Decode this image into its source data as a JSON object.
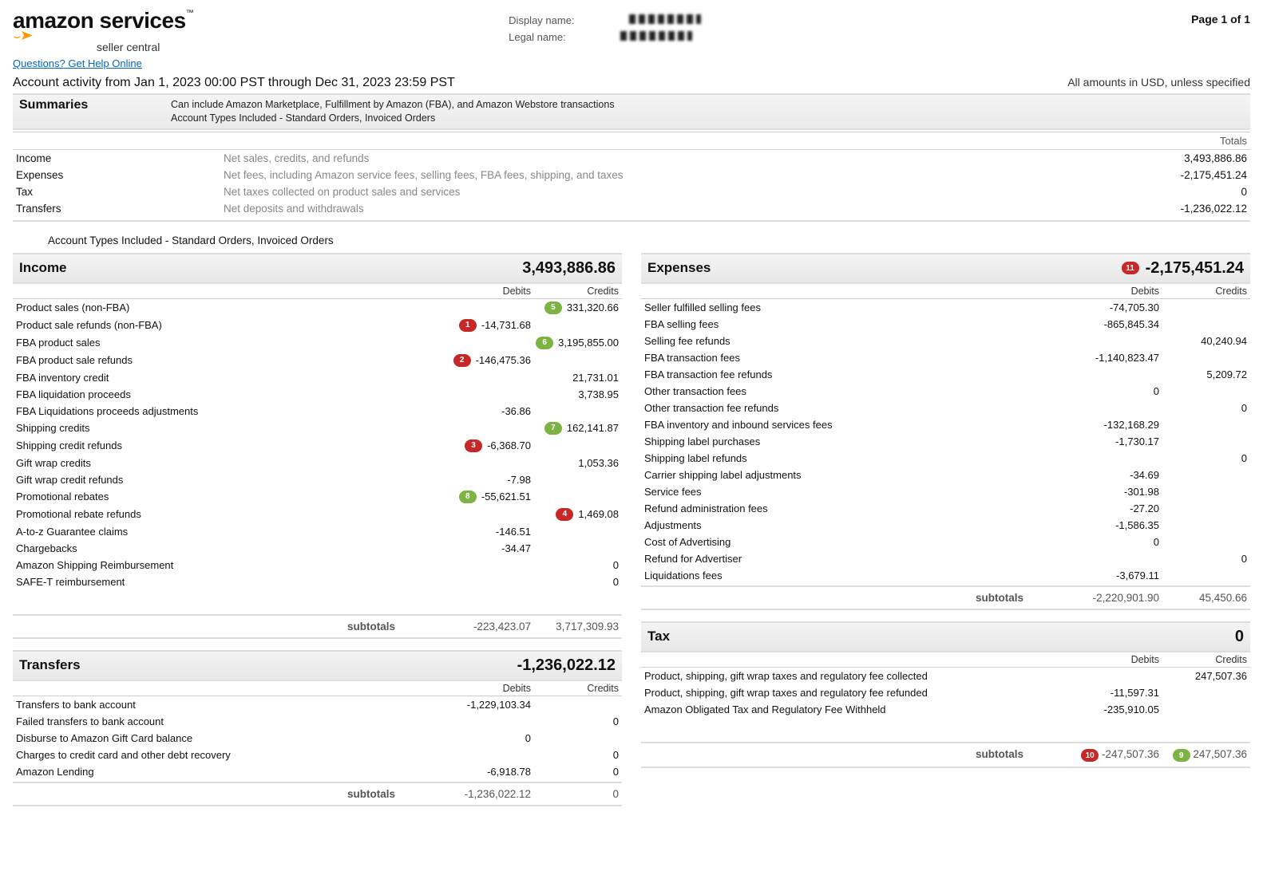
{
  "page": {
    "page_of": "Page 1 of 1",
    "display_name_label": "Display name:",
    "legal_name_label": "Legal name:",
    "help_link": "Questions? Get Help Online",
    "logo_main": "amazon",
    "logo_svc": "services",
    "logo_sub": "seller central",
    "trademark": "™"
  },
  "activity": {
    "range": "Account activity from Jan 1, 2023 00:00 PST through Dec 31, 2023 23:59 PST",
    "currency_note": "All amounts in USD, unless specified"
  },
  "summaries": {
    "title": "Summaries",
    "desc1": "Can include Amazon Marketplace, Fulfillment by Amazon (FBA), and Amazon Webstore transactions",
    "desc2": "Account Types Included - Standard Orders, Invoiced Orders",
    "totals_label": "Totals",
    "rows": [
      {
        "k": "Income",
        "d": "Net sales, credits, and refunds",
        "v": "3,493,886.86"
      },
      {
        "k": "Expenses",
        "d": "Net fees, including Amazon service fees, selling fees, FBA fees, shipping, and taxes",
        "v": "-2,175,451.24"
      },
      {
        "k": "Tax",
        "d": "Net taxes collected on product sales and services",
        "v": "0"
      },
      {
        "k": "Transfers",
        "d": "Net deposits and withdrawals",
        "v": "-1,236,022.12"
      }
    ]
  },
  "acct_types": "Account Types Included - Standard Orders, Invoiced Orders",
  "columns": {
    "debits": "Debits",
    "credits": "Credits",
    "subtotals": "subtotals"
  },
  "income": {
    "title": "Income",
    "total": "3,493,886.86",
    "rows": [
      {
        "lbl": "Product sales (non-FBA)",
        "d": "",
        "c": "331,320.66",
        "cb": "5"
      },
      {
        "lbl": "Product sale refunds (non-FBA)",
        "d": "-14,731.68",
        "db": "1",
        "c": ""
      },
      {
        "lbl": "FBA product sales",
        "d": "",
        "c": "3,195,855.00",
        "cb": "6"
      },
      {
        "lbl": "FBA product sale refunds",
        "d": "-146,475.36",
        "db": "2",
        "c": ""
      },
      {
        "lbl": "FBA inventory credit",
        "d": "",
        "c": "21,731.01"
      },
      {
        "lbl": "FBA liquidation proceeds",
        "d": "",
        "c": "3,738.95"
      },
      {
        "lbl": "FBA Liquidations proceeds adjustments",
        "d": "-36.86",
        "c": ""
      },
      {
        "lbl": "Shipping credits",
        "d": "",
        "c": "162,141.87",
        "cb": "7"
      },
      {
        "lbl": "Shipping credit refunds",
        "d": "-6,368.70",
        "db": "3",
        "c": ""
      },
      {
        "lbl": "Gift wrap credits",
        "d": "",
        "c": "1,053.36"
      },
      {
        "lbl": "Gift wrap credit refunds",
        "d": "-7.98",
        "c": ""
      },
      {
        "lbl": "Promotional rebates",
        "d": "-55,621.51",
        "db_g": "8",
        "c": ""
      },
      {
        "lbl": "Promotional rebate refunds",
        "d": "",
        "c": "1,469.08",
        "cb_r": "4"
      },
      {
        "lbl": "A-to-z Guarantee claims",
        "d": "-146.51",
        "c": ""
      },
      {
        "lbl": "Chargebacks",
        "d": "-34.47",
        "c": ""
      },
      {
        "lbl": "Amazon Shipping Reimbursement",
        "d": "",
        "c": "0"
      },
      {
        "lbl": "SAFE-T reimbursement",
        "d": "",
        "c": "0"
      }
    ],
    "sub_d": "-223,423.07",
    "sub_c": "3,717,309.93"
  },
  "transfers": {
    "title": "Transfers",
    "total": "-1,236,022.12",
    "rows": [
      {
        "lbl": "Transfers to bank account",
        "d": "-1,229,103.34",
        "c": ""
      },
      {
        "lbl": "Failed transfers to bank account",
        "d": "",
        "c": "0"
      },
      {
        "lbl": "Disburse to Amazon Gift Card balance",
        "d": "0",
        "c": ""
      },
      {
        "lbl": "Charges to credit card and other debt recovery",
        "d": "",
        "c": "0"
      },
      {
        "lbl": "Amazon Lending",
        "d": "-6,918.78",
        "c": "0"
      }
    ],
    "sub_d": "-1,236,022.12",
    "sub_c": "0"
  },
  "expenses": {
    "title": "Expenses",
    "total": "-2,175,451.24",
    "total_badge": "11",
    "rows": [
      {
        "lbl": "Seller fulfilled selling fees",
        "d": "-74,705.30",
        "c": ""
      },
      {
        "lbl": "FBA selling fees",
        "d": "-865,845.34",
        "c": ""
      },
      {
        "lbl": "Selling fee refunds",
        "d": "",
        "c": "40,240.94"
      },
      {
        "lbl": "FBA transaction fees",
        "d": "-1,140,823.47",
        "c": ""
      },
      {
        "lbl": "FBA transaction fee refunds",
        "d": "",
        "c": "5,209.72"
      },
      {
        "lbl": "Other transaction fees",
        "d": "0",
        "c": ""
      },
      {
        "lbl": "Other transaction fee refunds",
        "d": "",
        "c": "0"
      },
      {
        "lbl": "FBA inventory and inbound services fees",
        "d": "-132,168.29",
        "c": ""
      },
      {
        "lbl": "Shipping label purchases",
        "d": "-1,730.17",
        "c": ""
      },
      {
        "lbl": "Shipping label refunds",
        "d": "",
        "c": "0"
      },
      {
        "lbl": "Carrier shipping label adjustments",
        "d": "-34.69",
        "c": ""
      },
      {
        "lbl": "Service fees",
        "d": "-301.98",
        "c": ""
      },
      {
        "lbl": "Refund administration fees",
        "d": "-27.20",
        "c": ""
      },
      {
        "lbl": "Adjustments",
        "d": "-1,586.35",
        "c": ""
      },
      {
        "lbl": "Cost of Advertising",
        "d": "0",
        "c": ""
      },
      {
        "lbl": "Refund for Advertiser",
        "d": "",
        "c": "0"
      },
      {
        "lbl": "Liquidations fees",
        "d": "-3,679.11",
        "c": ""
      }
    ],
    "sub_d": "-2,220,901.90",
    "sub_c": "45,450.66"
  },
  "tax": {
    "title": "Tax",
    "total": "0",
    "rows": [
      {
        "lbl": "Product, shipping, gift wrap taxes and regulatory fee collected",
        "d": "",
        "c": "247,507.36"
      },
      {
        "lbl": "Product, shipping, gift wrap taxes and regulatory fee refunded",
        "d": "-11,597.31",
        "c": ""
      },
      {
        "lbl": "Amazon Obligated Tax and Regulatory Fee Withheld",
        "d": "-235,910.05",
        "c": ""
      }
    ],
    "sub_d": "-247,507.36",
    "sub_db": "10",
    "sub_c": "247,507.36",
    "sub_cb": "9"
  }
}
